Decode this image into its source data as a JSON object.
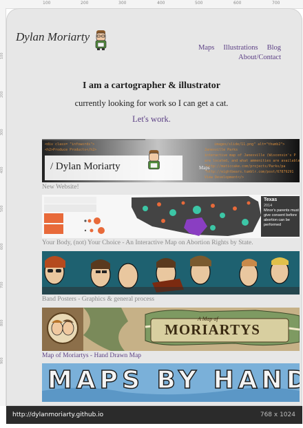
{
  "ruler": {
    "top_labels": [
      "100",
      "200",
      "300",
      "400",
      "500",
      "600",
      "700"
    ],
    "left_labels": [
      "100",
      "200",
      "300",
      "400",
      "500",
      "600",
      "700",
      "800",
      "900"
    ]
  },
  "header": {
    "name": "Dylan Moriarty",
    "nav": [
      "Maps",
      "Illustrations",
      "Blog",
      "About/Contact"
    ]
  },
  "intro": {
    "title": "I am a cartographer & illustrator",
    "subtitle": "currently looking for work so I can get a cat.",
    "cta": "Let's work."
  },
  "projects": [
    {
      "caption": "New Website!",
      "label": "/ Dylan Moriarty",
      "label2": "Maps"
    },
    {
      "caption": "Your Body, (not) Your Choice - An Interactive Map on Abortion Rights by State.",
      "state": "Texas",
      "year": "2014",
      "info": "Minor's parents must give consent before abortion can be performed"
    },
    {
      "caption": "Band Posters - Graphics & general process"
    },
    {
      "caption": "Map of Moriartys - Hand Drawn Map",
      "banner_small": "A Map of",
      "banner_big": "MORIARTYS"
    },
    {
      "caption": "",
      "banner": "MAPS BY HAND"
    }
  ],
  "status": {
    "url": "http://dylanmoriarty.github.io",
    "viewport": "768 x 1024"
  },
  "colors": {
    "accent": "#5b3f84",
    "frame": "#e7e7e7",
    "page": "#eeeeee"
  }
}
